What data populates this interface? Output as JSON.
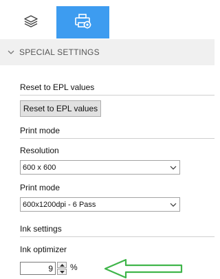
{
  "tabs": [
    {
      "icon": "layers-icon",
      "selected": false
    },
    {
      "icon": "printer-settings-icon",
      "selected": true
    }
  ],
  "section": {
    "title": "SPECIAL SETTINGS",
    "expanded": true
  },
  "reset": {
    "label": "Reset to EPL values",
    "button_label": "Reset to EPL values"
  },
  "print_mode_group": {
    "label": "Print mode"
  },
  "resolution": {
    "label": "Resolution",
    "value": "600 x 600"
  },
  "print_mode": {
    "label": "Print mode",
    "value": "600x1200dpi - 6 Pass"
  },
  "ink_settings": {
    "label": "Ink settings"
  },
  "ink_optimizer": {
    "label": "Ink optimizer",
    "value": "9",
    "unit": "%"
  },
  "colors": {
    "accent": "#3d9cf0",
    "annotation_arrow": "#3fb54a",
    "header_bg": "#f0f0f0"
  }
}
